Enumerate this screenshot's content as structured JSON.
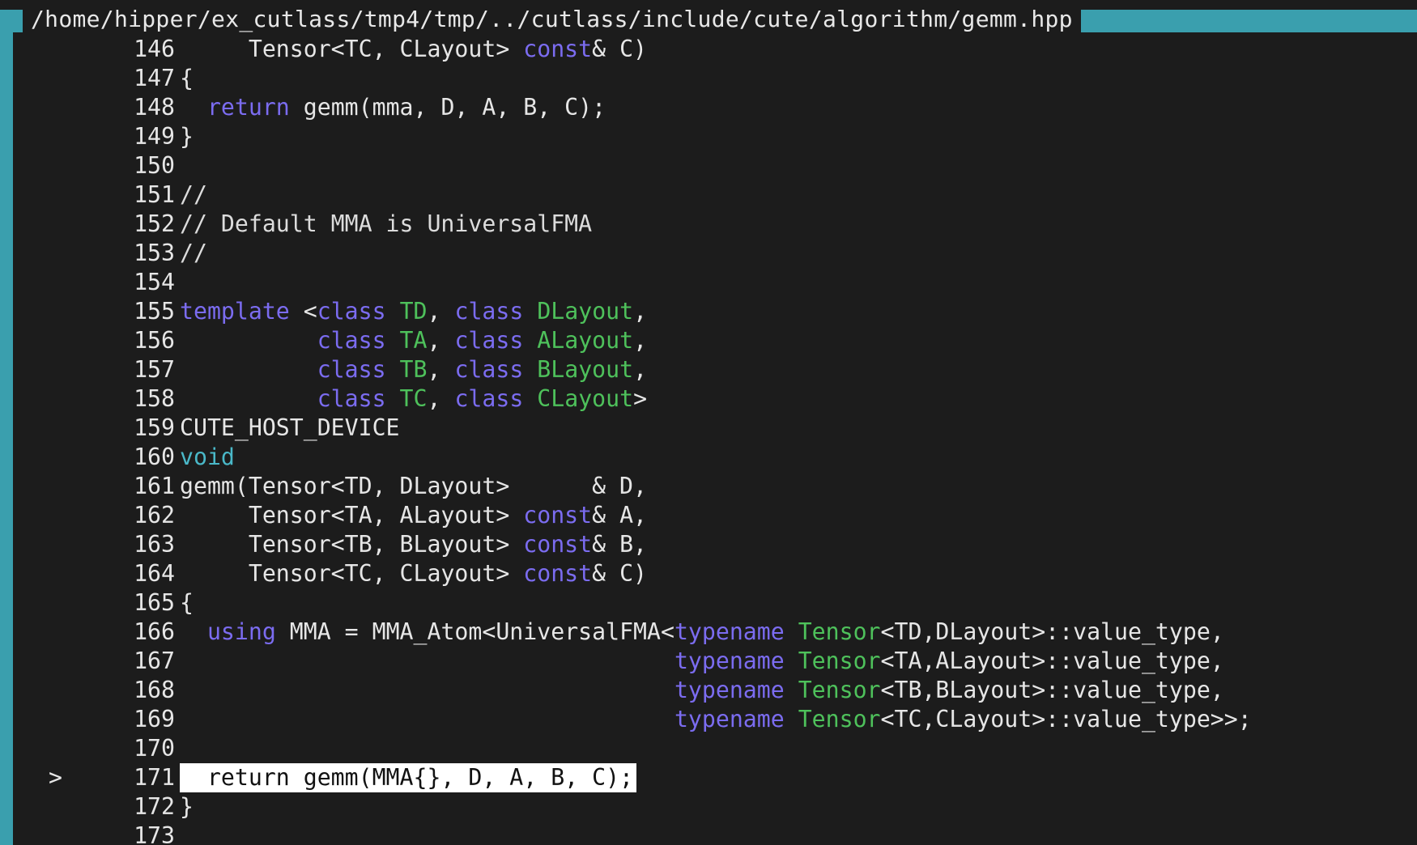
{
  "window": {
    "title": "/home/hipper/ex_cutlass/tmp4/tmp/../cutlass/include/cute/algorithm/gemm.hpp"
  },
  "colors": {
    "border": "#3a9fae",
    "background": "#1c1c1c",
    "keyword": "#7b6cf0",
    "type": "#4ec15b",
    "builtin": "#4ab8c8",
    "highlight_bg": "#ffffff"
  },
  "current_line": "171",
  "current_marker": ">",
  "lines": [
    {
      "n": "146",
      "t": [
        {
          "s": "     Tensor<TC, CLayout> "
        },
        {
          "s": "const",
          "c": "kw"
        },
        {
          "s": "& C)"
        }
      ]
    },
    {
      "n": "147",
      "t": [
        {
          "s": "{"
        }
      ]
    },
    {
      "n": "148",
      "t": [
        {
          "s": "  "
        },
        {
          "s": "return",
          "c": "kw"
        },
        {
          "s": " gemm(mma, D, A, B, C);"
        }
      ]
    },
    {
      "n": "149",
      "t": [
        {
          "s": "}"
        }
      ]
    },
    {
      "n": "150",
      "t": []
    },
    {
      "n": "151",
      "t": [
        {
          "s": "//",
          "c": "cm"
        }
      ]
    },
    {
      "n": "152",
      "t": [
        {
          "s": "// Default MMA is UniversalFMA",
          "c": "cm"
        }
      ]
    },
    {
      "n": "153",
      "t": [
        {
          "s": "//",
          "c": "cm"
        }
      ]
    },
    {
      "n": "154",
      "t": []
    },
    {
      "n": "155",
      "t": [
        {
          "s": "template",
          "c": "kw"
        },
        {
          "s": " <"
        },
        {
          "s": "class",
          "c": "kw"
        },
        {
          "s": " "
        },
        {
          "s": "TD",
          "c": "ty"
        },
        {
          "s": ", "
        },
        {
          "s": "class",
          "c": "kw"
        },
        {
          "s": " "
        },
        {
          "s": "DLayout",
          "c": "ty"
        },
        {
          "s": ","
        }
      ]
    },
    {
      "n": "156",
      "t": [
        {
          "s": "          "
        },
        {
          "s": "class",
          "c": "kw"
        },
        {
          "s": " "
        },
        {
          "s": "TA",
          "c": "ty"
        },
        {
          "s": ", "
        },
        {
          "s": "class",
          "c": "kw"
        },
        {
          "s": " "
        },
        {
          "s": "ALayout",
          "c": "ty"
        },
        {
          "s": ","
        }
      ]
    },
    {
      "n": "157",
      "t": [
        {
          "s": "          "
        },
        {
          "s": "class",
          "c": "kw"
        },
        {
          "s": " "
        },
        {
          "s": "TB",
          "c": "ty"
        },
        {
          "s": ", "
        },
        {
          "s": "class",
          "c": "kw"
        },
        {
          "s": " "
        },
        {
          "s": "BLayout",
          "c": "ty"
        },
        {
          "s": ","
        }
      ]
    },
    {
      "n": "158",
      "t": [
        {
          "s": "          "
        },
        {
          "s": "class",
          "c": "kw"
        },
        {
          "s": " "
        },
        {
          "s": "TC",
          "c": "ty"
        },
        {
          "s": ", "
        },
        {
          "s": "class",
          "c": "kw"
        },
        {
          "s": " "
        },
        {
          "s": "CLayout",
          "c": "ty"
        },
        {
          "s": ">"
        }
      ]
    },
    {
      "n": "159",
      "t": [
        {
          "s": "CUTE_HOST_DEVICE"
        }
      ]
    },
    {
      "n": "160",
      "t": [
        {
          "s": "void",
          "c": "cy"
        }
      ]
    },
    {
      "n": "161",
      "t": [
        {
          "s": "gemm(Tensor<TD, DLayout>      & D,"
        }
      ]
    },
    {
      "n": "162",
      "t": [
        {
          "s": "     Tensor<TA, ALayout> "
        },
        {
          "s": "const",
          "c": "kw"
        },
        {
          "s": "& A,"
        }
      ]
    },
    {
      "n": "163",
      "t": [
        {
          "s": "     Tensor<TB, BLayout> "
        },
        {
          "s": "const",
          "c": "kw"
        },
        {
          "s": "& B,"
        }
      ]
    },
    {
      "n": "164",
      "t": [
        {
          "s": "     Tensor<TC, CLayout> "
        },
        {
          "s": "const",
          "c": "kw"
        },
        {
          "s": "& C)"
        }
      ]
    },
    {
      "n": "165",
      "t": [
        {
          "s": "{"
        }
      ]
    },
    {
      "n": "166",
      "t": [
        {
          "s": "  "
        },
        {
          "s": "using",
          "c": "kw"
        },
        {
          "s": " MMA = MMA_Atom<UniversalFMA<"
        },
        {
          "s": "typename",
          "c": "kw"
        },
        {
          "s": " "
        },
        {
          "s": "Tensor",
          "c": "ty"
        },
        {
          "s": "<TD,DLayout>::value_type,"
        }
      ]
    },
    {
      "n": "167",
      "t": [
        {
          "s": "                                    "
        },
        {
          "s": "typename",
          "c": "kw"
        },
        {
          "s": " "
        },
        {
          "s": "Tensor",
          "c": "ty"
        },
        {
          "s": "<TA,ALayout>::value_type,"
        }
      ]
    },
    {
      "n": "168",
      "t": [
        {
          "s": "                                    "
        },
        {
          "s": "typename",
          "c": "kw"
        },
        {
          "s": " "
        },
        {
          "s": "Tensor",
          "c": "ty"
        },
        {
          "s": "<TB,BLayout>::value_type,"
        }
      ]
    },
    {
      "n": "169",
      "t": [
        {
          "s": "                                    "
        },
        {
          "s": "typename",
          "c": "kw"
        },
        {
          "s": " "
        },
        {
          "s": "Tensor",
          "c": "ty"
        },
        {
          "s": "<TC,CLayout>::value_type>>;"
        }
      ]
    },
    {
      "n": "170",
      "t": []
    },
    {
      "n": "171",
      "t": [
        {
          "s": "  return gemm(MMA{}, D, A, B, C);"
        }
      ]
    },
    {
      "n": "172",
      "t": [
        {
          "s": "}"
        }
      ]
    },
    {
      "n": "173",
      "t": []
    }
  ]
}
